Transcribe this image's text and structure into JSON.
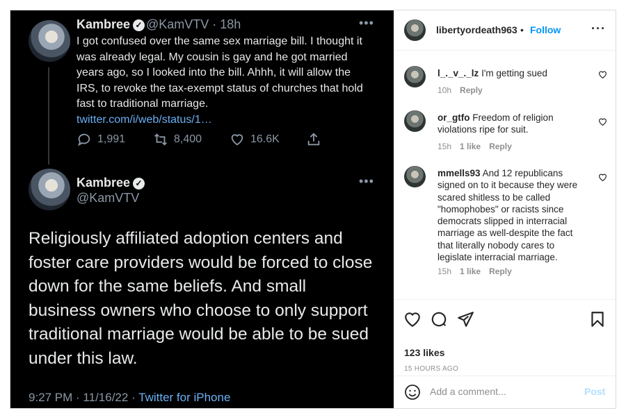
{
  "tweet": {
    "name": "Kambree",
    "handle_time": "@KamVTV · 18h",
    "body": "I got confused over the same sex marriage bill. I thought it was already legal. My cousin is gay and he got married years ago, so I looked into the bill. Ahhh, it will allow the IRS, to revoke the tax-exempt status of churches that hold fast to traditional marriage.",
    "link": "twitter.com/i/web/status/1…",
    "replies": "1,991",
    "retweets": "8,400",
    "likes": "16.6K"
  },
  "tweet2": {
    "name": "Kambree",
    "handle": "@KamVTV",
    "body": "Religiously affiliated adoption centers and foster care providers would be forced to close down for the same beliefs. And small business owners who choose to only support traditional marriage would be able to be sued under this law.",
    "timestamp": "9:27 PM · 11/16/22 · ",
    "source": "Twitter for iPhone"
  },
  "instagram": {
    "username": "libertyordeath963",
    "follow": "Follow",
    "comments": [
      {
        "user": "l_._v_._lz",
        "text": "I'm getting sued",
        "time": "10h",
        "likes": "",
        "reply": "Reply"
      },
      {
        "user": "or_gtfo",
        "text": "Freedom of religion violations ripe for suit.",
        "time": "15h",
        "likes": "1 like",
        "reply": "Reply"
      },
      {
        "user": "mmells93",
        "text": "And 12 republicans signed on to it because they were scared shitless to be called \"homophobes\" or racists since democrats slipped in interracial marriage as well-despite the fact that literally nobody cares to legislate interracial marriage.",
        "time": "15h",
        "likes": "1 like",
        "reply": "Reply"
      }
    ],
    "likes": "123 likes",
    "posted": "15 HOURS AGO",
    "comment_placeholder": "Add a comment...",
    "post": "Post"
  }
}
